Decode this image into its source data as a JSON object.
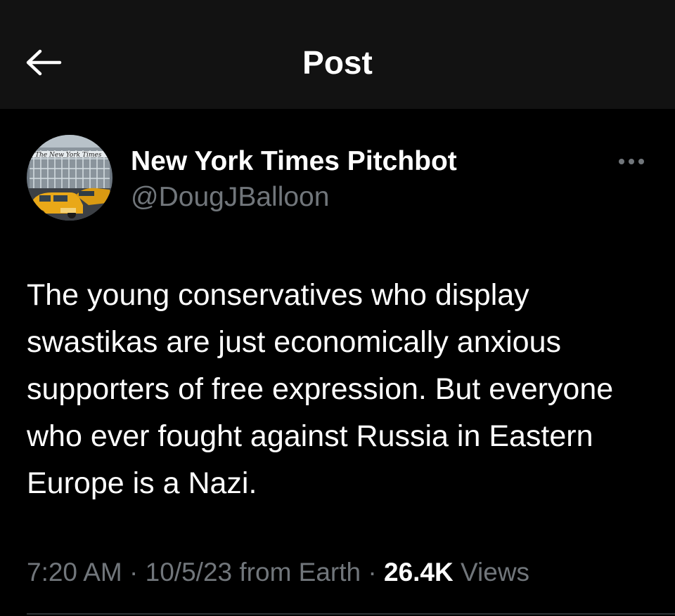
{
  "header": {
    "title": "Post",
    "back_icon": "arrow-left-icon"
  },
  "post": {
    "author": {
      "display_name": "New York Times Pitchbot",
      "handle": "@DougJBalloon",
      "avatar_icon": "nyt-building-avatar"
    },
    "more_icon": "more-horizontal-icon",
    "text": "The young conservatives who display swastikas are just economically anxious supporters of free expression. But everyone who ever fought against Russia in Eastern Europe is a Nazi.",
    "time": "7:20 AM",
    "date": "10/5/23",
    "source": "from Earth",
    "separator": "·",
    "views_count": "26.4K",
    "views_label": "Views"
  },
  "colors": {
    "background": "#000000",
    "header_background": "#121212",
    "primary_text": "#ffffff",
    "secondary_text": "#71767b"
  }
}
